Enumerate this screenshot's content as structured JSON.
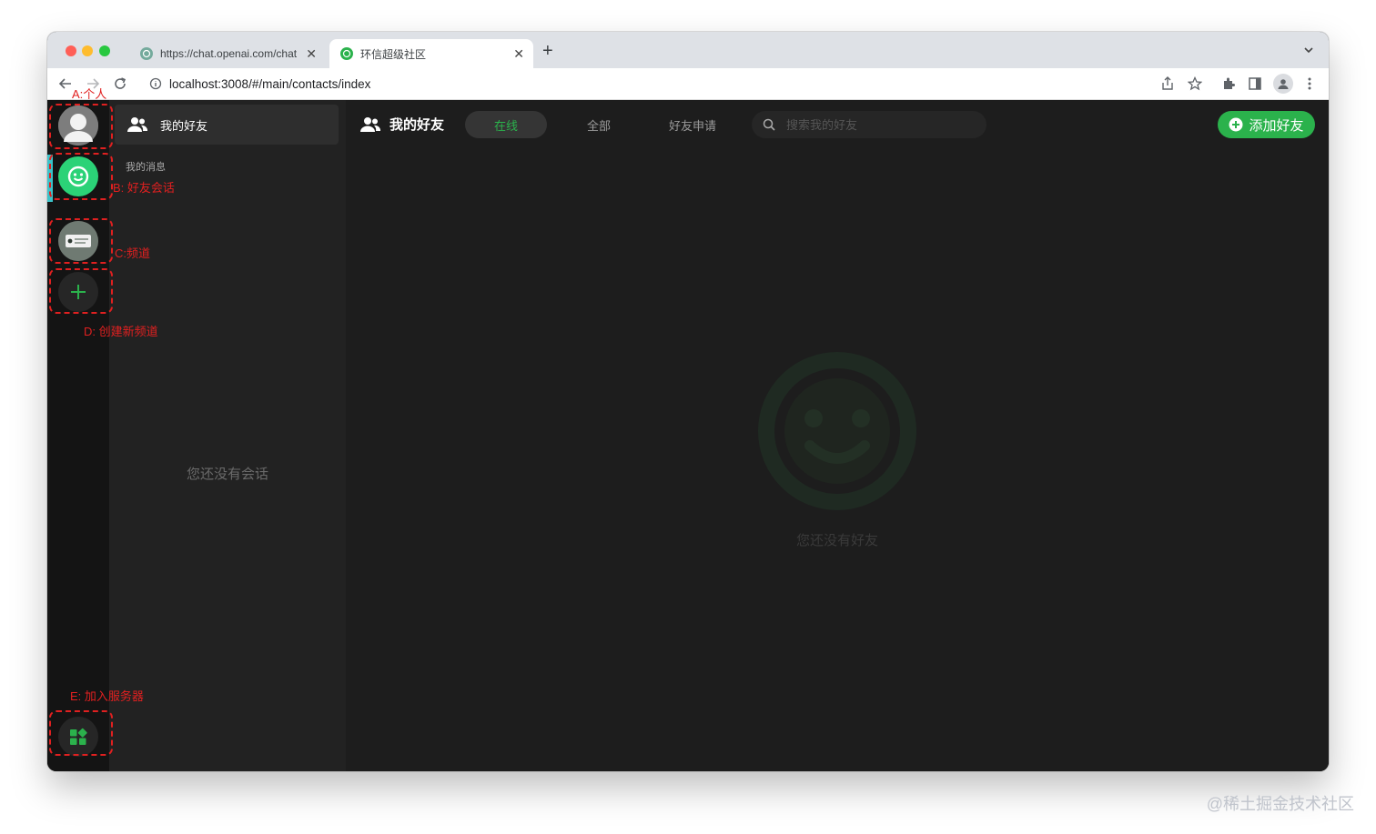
{
  "browser": {
    "tabs": [
      {
        "title": "https://chat.openai.com/chat",
        "active": false
      },
      {
        "title": "环信超级社区",
        "active": true
      }
    ],
    "url": "localhost:3008/#/main/contacts/index"
  },
  "sidebar": {
    "header_label": "我的好友",
    "section_label": "我的消息",
    "empty_text": "您还没有会话"
  },
  "main": {
    "title": "我的好友",
    "filters": [
      {
        "label": "在线",
        "active": true
      },
      {
        "label": "全部",
        "active": false
      },
      {
        "label": "好友申请",
        "active": false
      }
    ],
    "search_placeholder": "搜索我的好友",
    "add_friend_label": "添加好友",
    "empty_text": "您还没有好友"
  },
  "annotations": {
    "a": "A:个人",
    "b": "B: 好友会话",
    "c": "C:频道",
    "d": "D: 创建新频道",
    "e": "E: 加入服务器"
  },
  "watermark": "@稀土掘金技术社区",
  "colors": {
    "accent_green": "#2bb24c",
    "annotation_red": "#e02020",
    "active_teal": "#3bc2c9"
  }
}
